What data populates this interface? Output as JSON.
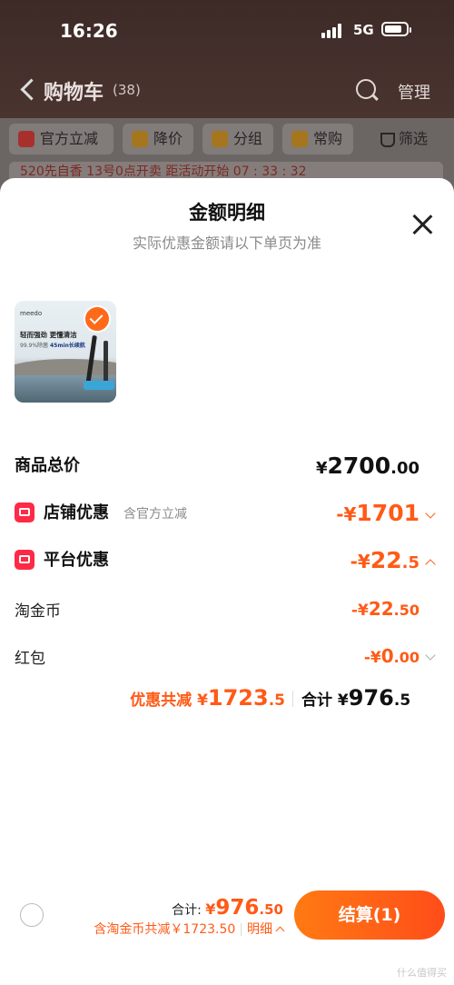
{
  "status_bar": {
    "time": "16:26",
    "network": "5G"
  },
  "navbar": {
    "title": "购物车",
    "count": "(38)",
    "manage": "管理"
  },
  "filter_chips": [
    "官方立减",
    "降价",
    "分组",
    "常购",
    "筛选"
  ],
  "promo_strip": "520先自香 13号0点开卖 距活动开始 07 : 33 : 32",
  "sheet": {
    "title": "金额明细",
    "subtitle": "实际优惠金额请以下单页为准",
    "product": {
      "brand": "meedo",
      "line1": "轻而强劲 更懂清洁",
      "line2_a": "99.9%除菌",
      "line2_b": "45min长续航"
    },
    "rows": {
      "total_price": {
        "label": "商品总价",
        "currency": "¥",
        "int": "2700",
        "dec": ".00"
      },
      "shop_discount": {
        "label": "店铺优惠",
        "note": "含官方立减",
        "currency": "-¥",
        "int": "1701",
        "dec": ""
      },
      "platform_discount": {
        "label": "平台优惠",
        "currency": "-¥",
        "int": "22",
        "dec": ".5"
      },
      "coins": {
        "label": "淘金币",
        "currency": "-¥",
        "int": "22",
        "dec": ".50"
      },
      "red_packet": {
        "label": "红包",
        "currency": "-¥",
        "int": "0",
        "dec": ".00"
      }
    },
    "summary": {
      "discount_label": "优惠共减",
      "discount_currency": "¥",
      "discount_int": "1723",
      "discount_dec": ".5",
      "total_label": "合计",
      "total_currency": "¥",
      "total_int": "976",
      "total_dec": ".5"
    }
  },
  "bottom_bar": {
    "total_label": "合计:",
    "total_currency": "¥",
    "total_int": "976",
    "total_dec": ".50",
    "coins_note": "含淘金币共减￥1723.50",
    "detail": "明细",
    "checkout": "结算(1)"
  },
  "watermark": "什么值得买",
  "colors": {
    "accent": "#ff5a16",
    "badge_red": "#ff2a45",
    "check_orange": "#ff6a1a"
  }
}
